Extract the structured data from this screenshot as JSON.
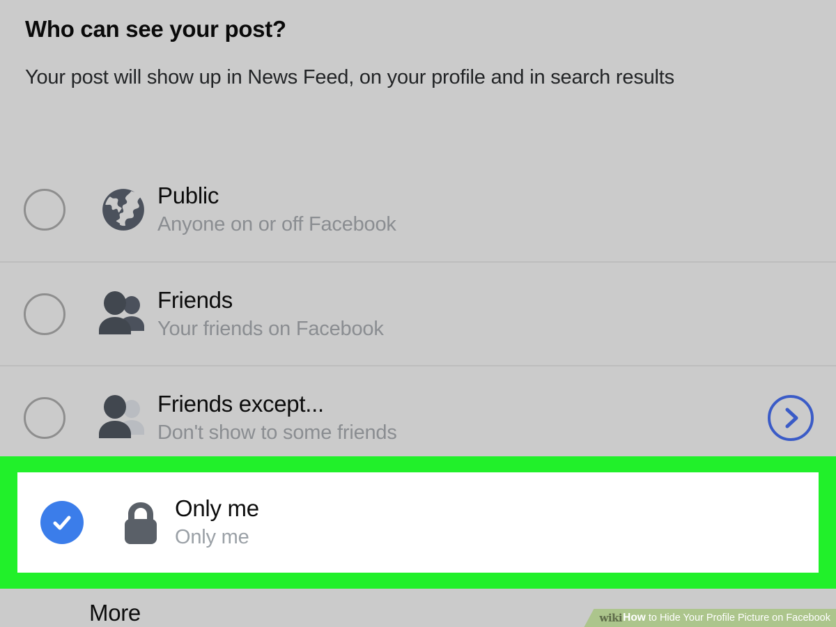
{
  "dialog": {
    "title": "Who can see your post?",
    "subtitle": "Your post will show up in News Feed, on your profile and in search results"
  },
  "options": [
    {
      "title": "Public",
      "subtitle": "Anyone on or off Facebook",
      "icon": "globe-icon",
      "selected": false,
      "has_chevron": false
    },
    {
      "title": "Friends",
      "subtitle": "Your friends on Facebook",
      "icon": "friends-icon",
      "selected": false,
      "has_chevron": false
    },
    {
      "title": "Friends except...",
      "subtitle": "Don't show to some friends",
      "icon": "friends-except-icon",
      "selected": false,
      "has_chevron": true
    },
    {
      "title": "Only me",
      "subtitle": "Only me",
      "icon": "lock-icon",
      "selected": true,
      "has_chevron": false
    }
  ],
  "footer": {
    "more_label": "More"
  },
  "watermark": {
    "wiki": "wiki",
    "how": "How",
    "rest": "to Hide Your Profile Picture on Facebook"
  },
  "colors": {
    "background": "#cbcbcb",
    "highlight_green": "#21f02a",
    "selected_blue": "#3b7dea",
    "chevron_blue": "#3a5bc7",
    "icon_grey": "#4b515c",
    "icon_grey_faded": "#b9bcc1",
    "subtitle_grey": "#8a8d91",
    "watermark_band": "#acc58c"
  }
}
